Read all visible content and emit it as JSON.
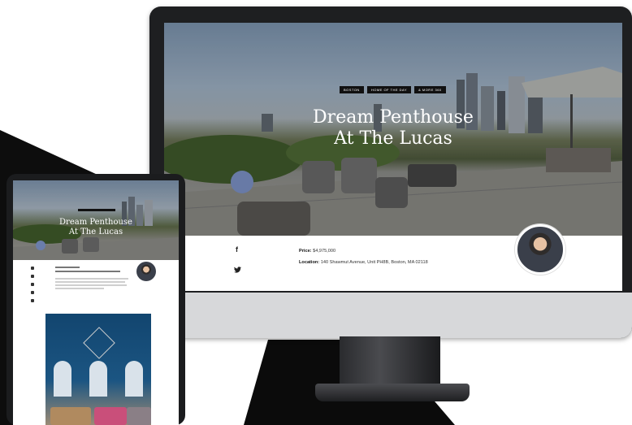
{
  "desktop": {
    "tags": [
      "BOSTON",
      "HOME OF THE DAY",
      "& MORE 360"
    ],
    "title_line1": "Dream Penthouse",
    "title_line2": "At The Lucas",
    "social": {
      "facebook": "f",
      "twitter": "•"
    },
    "price_label": "Price:",
    "price_value": "$4,975,000",
    "location_label": "Location:",
    "location_value": "140 Shawmut Avenue, Unit PH8B, Boston, MA 02118"
  },
  "tablet": {
    "title_line1": "Dream Penthouse",
    "title_line2": "At The Lucas"
  },
  "colors": {
    "bezel": "#1e1f21",
    "chin": "#d7d8da",
    "tag_bg": "#111111",
    "room_wall": "#12456f"
  }
}
